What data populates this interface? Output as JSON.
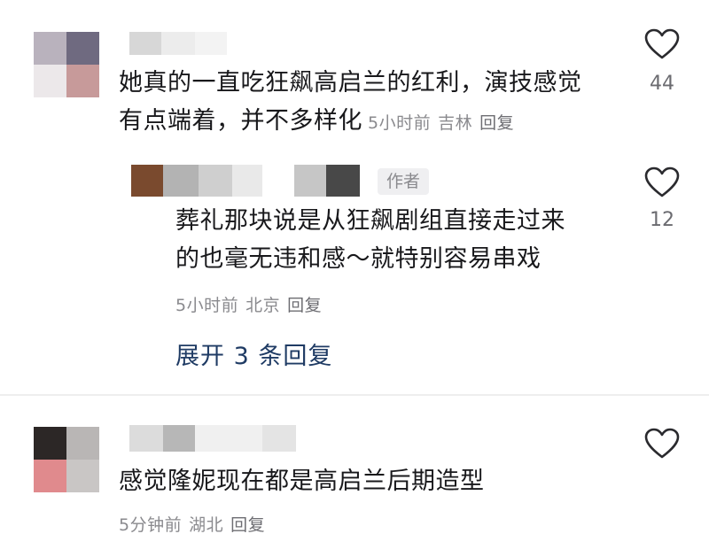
{
  "comments": [
    {
      "text_line1": "她真的一直吃狂飙高启兰的红利，演技感觉",
      "text_line2": "有点端着，并不多样化",
      "time": "5小时前",
      "location": "吉林",
      "reply_label": "回复",
      "likes": "44",
      "icon": "heart-outline-icon"
    },
    {
      "text_line1": "感觉隆妮现在都是高启兰后期造型",
      "time": "5分钟前",
      "location": "湖北",
      "reply_label": "回复",
      "likes": "",
      "icon": "heart-outline-icon"
    }
  ],
  "reply": {
    "badge": "作者",
    "text_line1": "葬礼那块说是从狂飙剧组直接走过来",
    "text_line2": "的也毫无违和感～就特别容易串戏",
    "time": "5小时前",
    "location": "北京",
    "reply_label": "回复",
    "likes": "12",
    "icon": "heart-outline-icon"
  },
  "expand_label": "展开 3 条回复",
  "colors": {
    "text": "#18181b",
    "meta": "#8a8a8e",
    "link": "#1f3b64"
  }
}
